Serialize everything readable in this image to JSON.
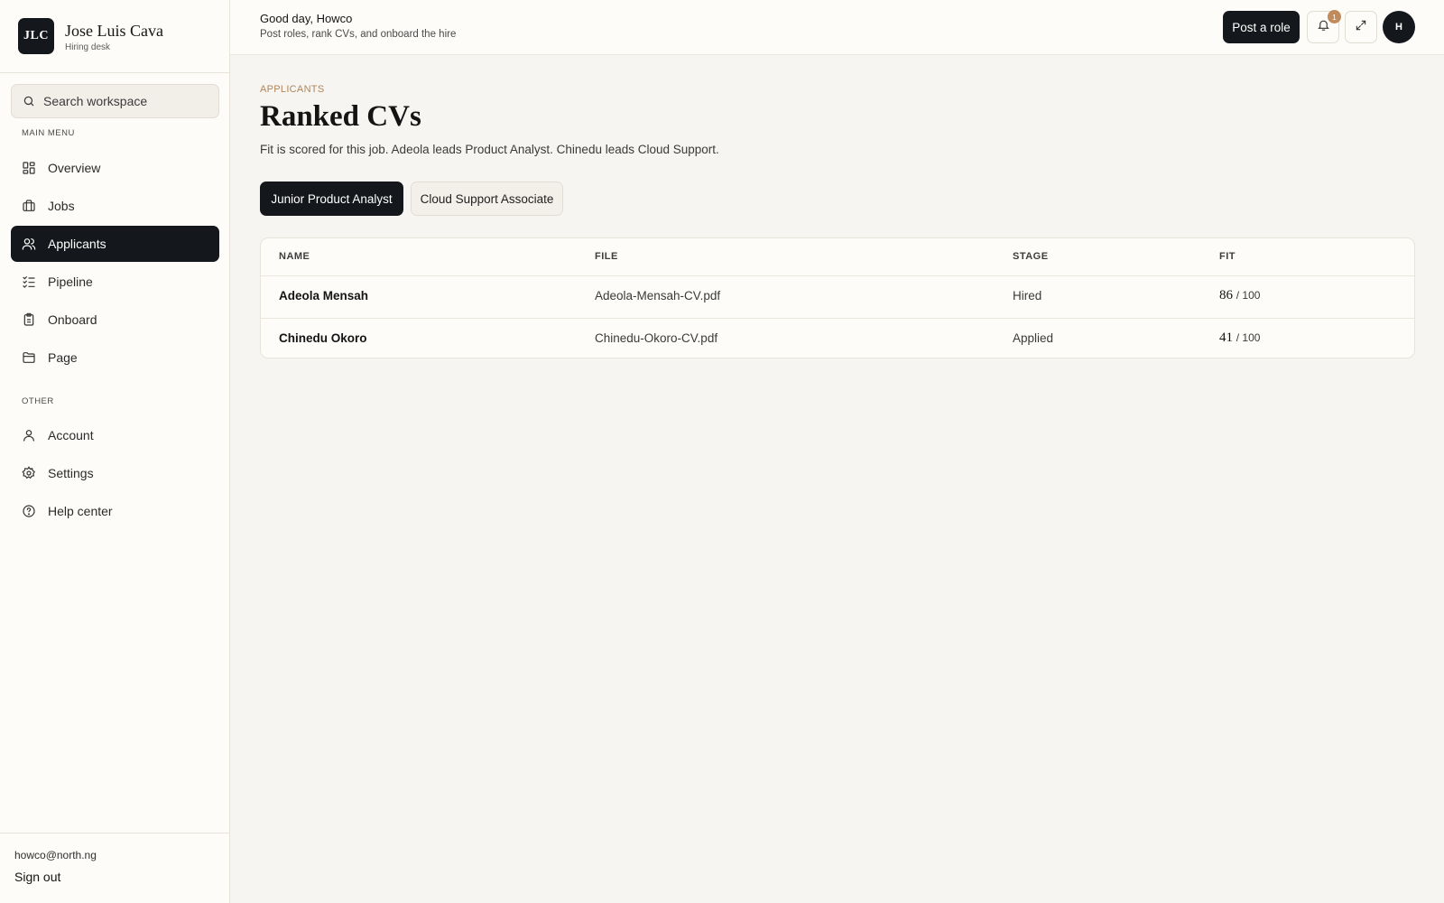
{
  "brand": {
    "logo": "JLC",
    "name": "Jose Luis Cava",
    "subtitle": "Hiring desk"
  },
  "search": {
    "placeholder": "Search workspace",
    "value": ""
  },
  "sidebar": {
    "main_label": "MAIN MENU",
    "main_items": [
      {
        "label": "Overview",
        "icon": "grid-icon"
      },
      {
        "label": "Jobs",
        "icon": "briefcase-icon"
      },
      {
        "label": "Applicants",
        "icon": "users-icon",
        "active": true
      },
      {
        "label": "Pipeline",
        "icon": "checklist-icon"
      },
      {
        "label": "Onboard",
        "icon": "clipboard-icon"
      },
      {
        "label": "Page",
        "icon": "folder-icon"
      }
    ],
    "other_label": "OTHER",
    "other_items": [
      {
        "label": "Account",
        "icon": "user-icon"
      },
      {
        "label": "Settings",
        "icon": "gear-icon"
      },
      {
        "label": "Help center",
        "icon": "help-circle-icon"
      }
    ],
    "footer": {
      "email": "howco@north.ng",
      "signout": "Sign out"
    }
  },
  "header": {
    "greeting": "Good day, Howco",
    "subtitle": "Post roles, rank CVs, and onboard the hire",
    "post_button": "Post a role",
    "notification_count": "1",
    "avatar_initial": "H"
  },
  "main": {
    "eyebrow": "APPLICANTS",
    "title": "Ranked CVs",
    "description": "Fit is scored for this job. Adeola leads Product Analyst. Chinedu leads Cloud Support.",
    "tabs": [
      {
        "label": "Junior Product Analyst",
        "active": true
      },
      {
        "label": "Cloud Support Associate",
        "active": false
      }
    ],
    "table": {
      "columns": [
        "NAME",
        "FILE",
        "STAGE",
        "FIT"
      ],
      "rows": [
        {
          "name": "Adeola Mensah",
          "file": "Adeola-Mensah-CV.pdf",
          "stage": "Hired",
          "fit": "86",
          "fit_total": "/ 100"
        },
        {
          "name": "Chinedu Okoro",
          "file": "Chinedu-Okoro-CV.pdf",
          "stage": "Applied",
          "fit": "41",
          "fit_total": "/ 100"
        }
      ]
    }
  },
  "colors": {
    "dark": "#14171b",
    "accent": "#b0855a",
    "badge": "#c08a5a",
    "background": "#f7f5f1"
  }
}
